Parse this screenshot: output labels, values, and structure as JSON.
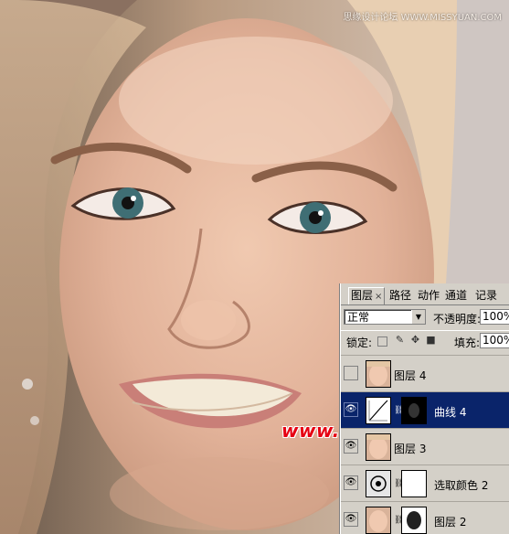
{
  "watermarks": {
    "top": "思缘设计论坛 WWW.MISSYUAN.COM",
    "main": "www.68ps.com"
  },
  "panel": {
    "tabs": [
      {
        "label": "图层",
        "active": true,
        "close": "×"
      },
      {
        "label": "路径"
      },
      {
        "label": "动作"
      },
      {
        "label": "通道"
      },
      {
        "label": "记录"
      }
    ],
    "blend_mode": "正常",
    "opacity_label": "不透明度:",
    "opacity_value": "100%",
    "lock_label": "锁定:",
    "fill_label": "填充:",
    "fill_value": "100%",
    "layers": [
      {
        "name": "图层 4",
        "visible": false,
        "selected": false,
        "type": "photo"
      },
      {
        "name": "曲线 4",
        "visible": true,
        "selected": true,
        "type": "curves"
      },
      {
        "name": "图层 3",
        "visible": true,
        "selected": false,
        "type": "photo"
      },
      {
        "name": "选取颜色 2",
        "visible": true,
        "selected": false,
        "type": "selective-color"
      },
      {
        "name": "图层 2",
        "visible": true,
        "selected": false,
        "type": "photo-mask"
      }
    ]
  },
  "colors": {
    "selection": "#0a246a",
    "panel_bg": "#d4d0c8",
    "watermark_red": "#e60012"
  }
}
